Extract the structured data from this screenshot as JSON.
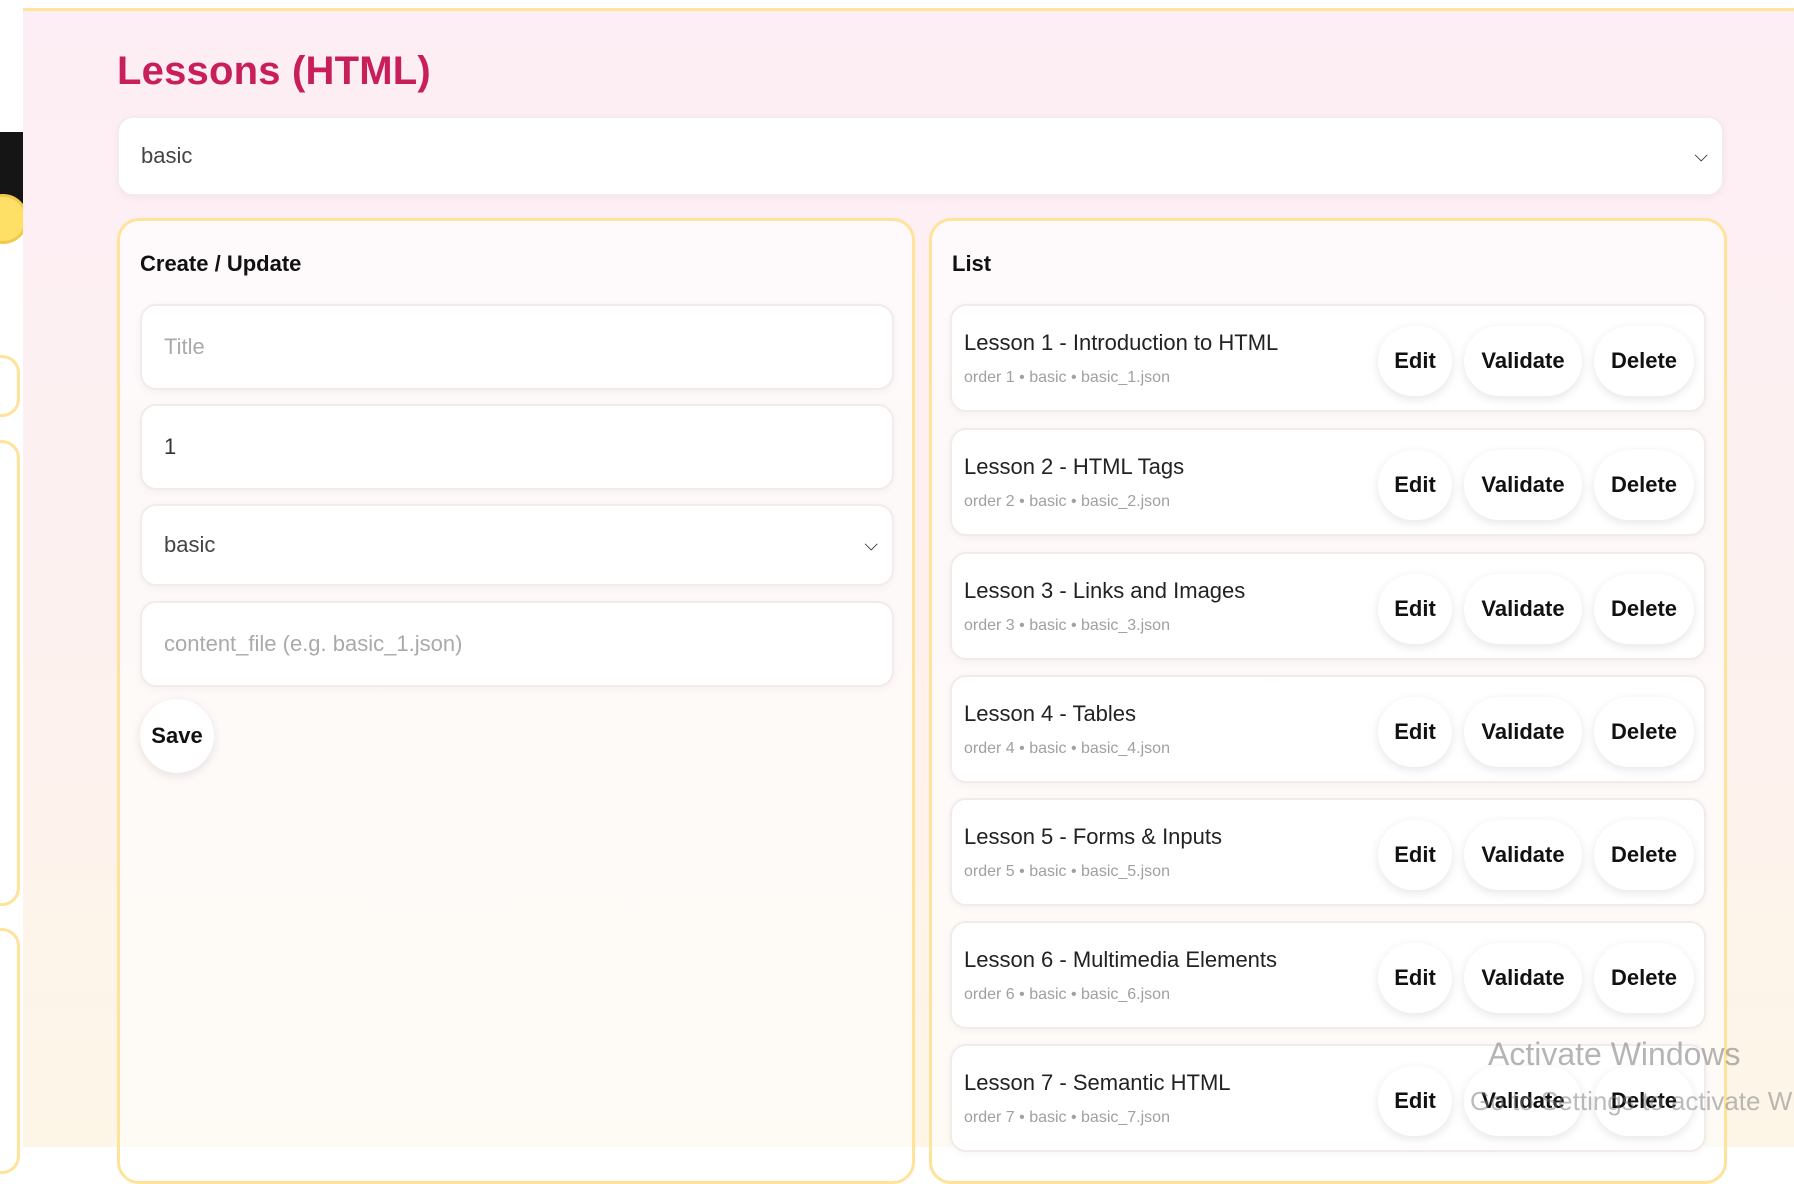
{
  "page_title": "Lessons (HTML)",
  "level_filter": {
    "value": "basic"
  },
  "form": {
    "title": "Create / Update",
    "title_placeholder": "Title",
    "order_value": "1",
    "level_value": "basic",
    "content_file_placeholder": "content_file (e.g. basic_1.json)",
    "save_label": "Save"
  },
  "list": {
    "title": "List",
    "actions": {
      "edit": "Edit",
      "validate": "Validate",
      "delete": "Delete"
    },
    "items": [
      {
        "title": "Lesson 1 - Introduction to HTML",
        "meta": "order 1 • basic • basic_1.json"
      },
      {
        "title": "Lesson 2 - HTML Tags",
        "meta": "order 2 • basic • basic_2.json"
      },
      {
        "title": "Lesson 3 - Links and Images",
        "meta": "order 3 • basic • basic_3.json"
      },
      {
        "title": "Lesson 4 - Tables",
        "meta": "order 4 • basic • basic_4.json"
      },
      {
        "title": "Lesson 5 - Forms & Inputs",
        "meta": "order 5 • basic • basic_5.json"
      },
      {
        "title": "Lesson 6 - Multimedia Elements",
        "meta": "order 6 • basic • basic_6.json"
      },
      {
        "title": "Lesson 7 - Semantic HTML",
        "meta": "order 7 • basic • basic_7.json"
      }
    ]
  },
  "watermark": {
    "title": "Activate Windows",
    "subtitle": "Go to Settings to activate Windows."
  },
  "colors": {
    "accent": "#c81e5a",
    "panel_border": "#ffe39a"
  }
}
